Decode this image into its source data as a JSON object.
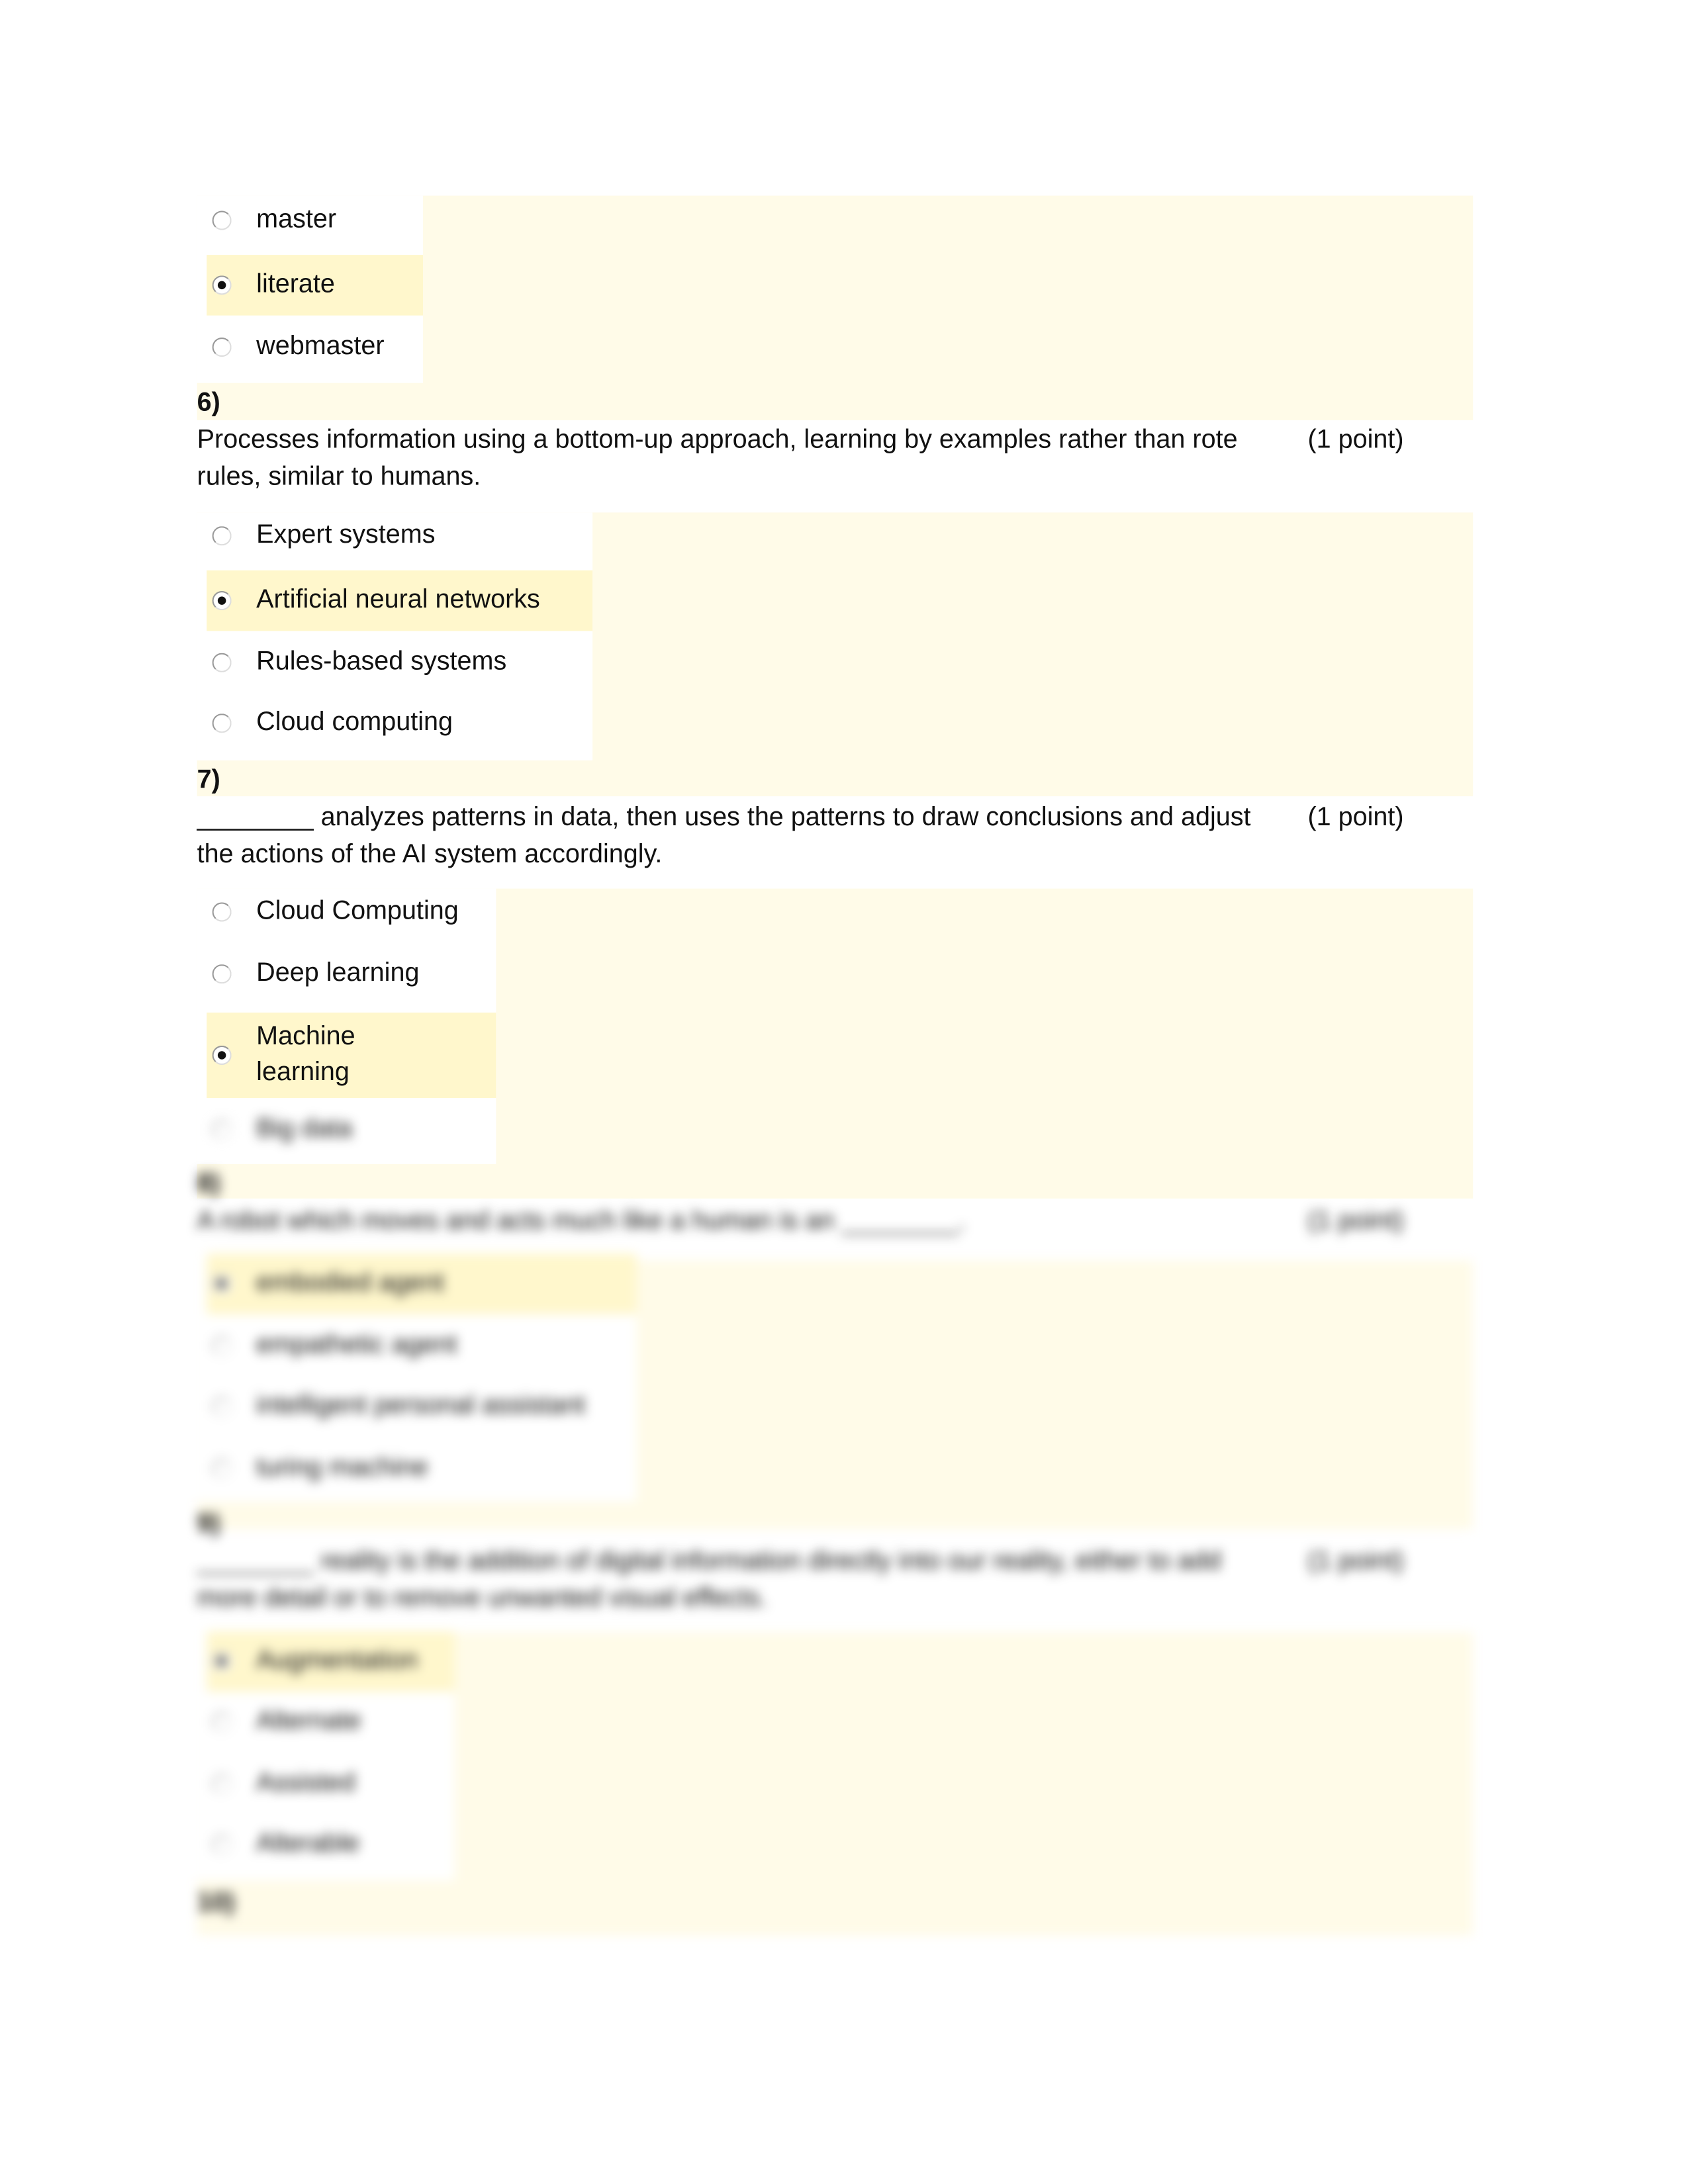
{
  "colors": {
    "panel": "#fffbe8",
    "selected": "#fff7cc"
  },
  "q5": {
    "options": [
      {
        "label": "master",
        "selected": false
      },
      {
        "label": "literate",
        "selected": true
      },
      {
        "label": "webmaster",
        "selected": false
      }
    ]
  },
  "q6": {
    "number": "6)",
    "text": "Processes information using a bottom-up approach, learning by examples rather than rote rules, similar to humans.",
    "points": "(1 point)",
    "options": [
      {
        "label": "Expert systems",
        "selected": false
      },
      {
        "label": "Artificial neural networks",
        "selected": true
      },
      {
        "label": "Rules-based systems",
        "selected": false
      },
      {
        "label": "Cloud computing",
        "selected": false
      }
    ]
  },
  "q7": {
    "number": "7)",
    "text": "________ analyzes patterns in data, then uses the patterns to draw conclusions and adjust the actions of the AI system accordingly.",
    "points": "(1 point)",
    "options": [
      {
        "label": "Cloud Computing",
        "selected": false
      },
      {
        "label": "Deep learning",
        "selected": false
      },
      {
        "label": "Machine learning",
        "selected": true
      },
      {
        "label": "Big data",
        "selected": false
      }
    ]
  },
  "q8": {
    "number": "8)",
    "text": "A robot which moves and acts much like a human is an ________.",
    "points": "(1 point)",
    "options": [
      {
        "label": "embodied agent",
        "selected": true
      },
      {
        "label": "empathetic agent",
        "selected": false
      },
      {
        "label": "intelligent personal assistant",
        "selected": false
      },
      {
        "label": "turing machine",
        "selected": false
      }
    ]
  },
  "q9": {
    "number": "9)",
    "text": "________ reality is the addition of digital information directly into our reality, either to add more detail or to remove unwanted visual effects.",
    "points": "(1 point)",
    "options": [
      {
        "label": "Augmentation",
        "selected": true
      },
      {
        "label": "Alternate",
        "selected": false
      },
      {
        "label": "Assisted",
        "selected": false
      },
      {
        "label": "Alterable",
        "selected": false
      }
    ]
  },
  "q10": {
    "number": "10)"
  }
}
